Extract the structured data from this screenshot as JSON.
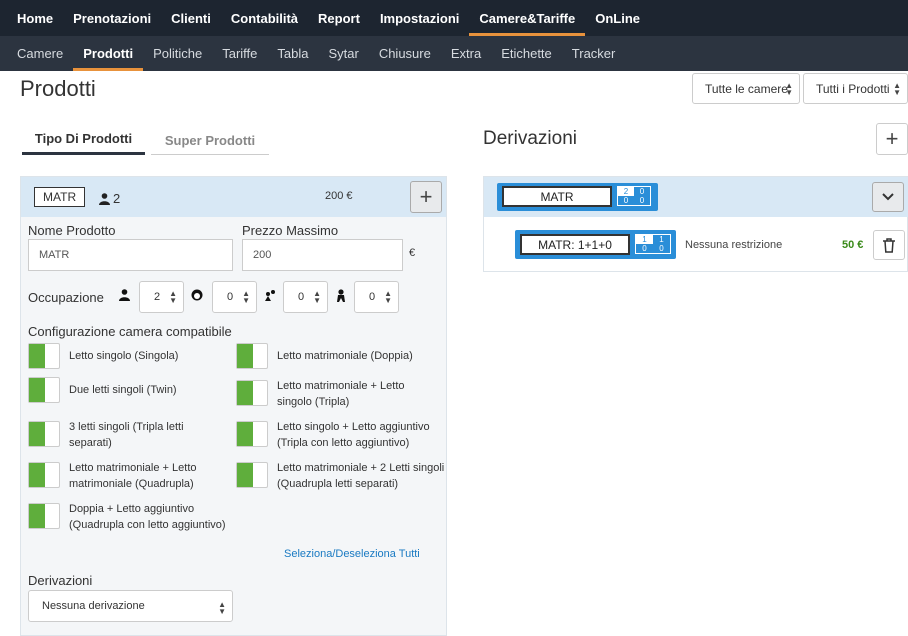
{
  "topnav": [
    "Home",
    "Prenotazioni",
    "Clienti",
    "Contabilità",
    "Report",
    "Impostazioni",
    "Camere&Tariffe",
    "OnLine"
  ],
  "topnav_active": 6,
  "subnav": [
    "Camere",
    "Prodotti",
    "Politiche",
    "Tariffe",
    "Tabla",
    "Sytar",
    "Chiusure",
    "Extra",
    "Etichette",
    "Tracker"
  ],
  "subnav_active": 1,
  "page_title": "Prodotti",
  "filters": {
    "camere": "Tutte le camere",
    "prodotti": "Tutti i Prodotti"
  },
  "tabs": {
    "tipo": "Tipo Di Prodotti",
    "super": "Super Prodotti"
  },
  "product": {
    "badge": "MATR",
    "persons": "2",
    "price": "200 €",
    "nome_label": "Nome Prodotto",
    "nome_value": "MATR",
    "prezzo_label": "Prezzo Massimo",
    "prezzo_value": "200",
    "currency": "€",
    "occupazione_label": "Occupazione",
    "occ": [
      "2",
      "0",
      "0",
      "0"
    ],
    "config_label": "Configurazione camera compatibile",
    "configs": [
      "Letto singolo (Singola)",
      "Letto matrimoniale (Doppia)",
      "Due letti singoli (Twin)",
      "Letto matrimoniale + Letto singolo (Tripla)",
      "3 letti singoli (Tripla letti separati)",
      "Letto singolo + Letto aggiuntivo (Tripla con letto aggiuntivo)",
      "Letto matrimoniale + Letto matrimoniale (Quadrupla)",
      "Letto matrimoniale + 2 Letti singoli (Quadrupla letti separati)",
      "Doppia + Letto aggiuntivo (Quadrupla con letto aggiuntivo)"
    ],
    "select_all": "Seleziona/Deseleziona Tutti",
    "derivazioni_label": "Derivazioni",
    "derivazioni_value": "Nessuna derivazione"
  },
  "derivazioni": {
    "title": "Derivazioni",
    "head": {
      "name": "MATR",
      "grid": [
        "2",
        "0",
        "0",
        "0"
      ]
    },
    "row": {
      "name": "MATR: 1+1+0",
      "grid": [
        "1",
        "1",
        "0",
        "0"
      ],
      "restriction": "Nessuna restrizione",
      "amount": "50 €"
    }
  },
  "colors": {
    "accent": "#e8923c",
    "nav": "#1d2530",
    "toggle": "#5fae3c",
    "pill": "#2a8ed8"
  }
}
